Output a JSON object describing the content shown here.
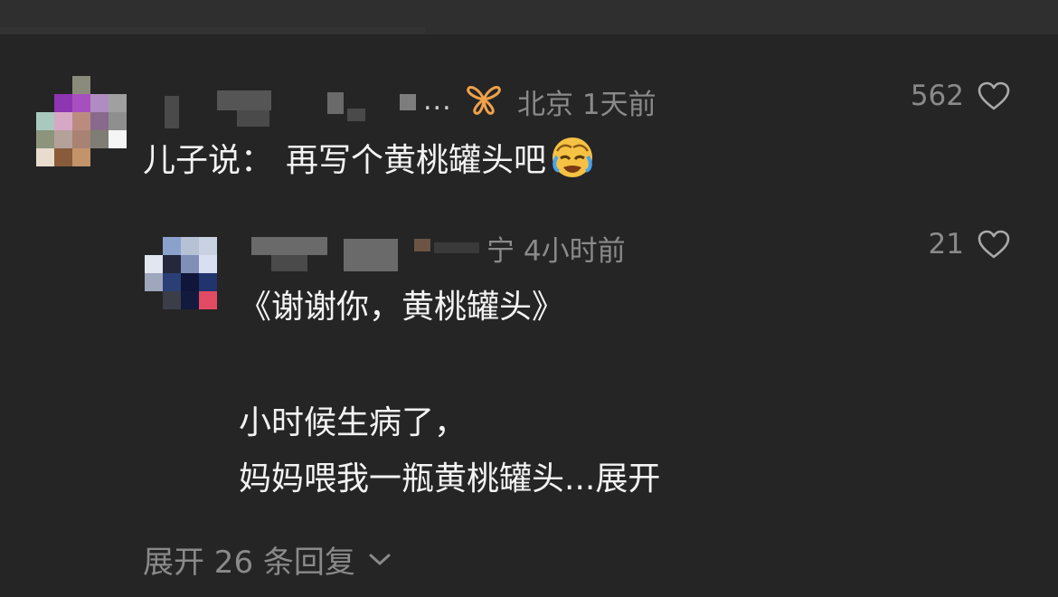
{
  "colors": {
    "background": "#252525",
    "top_bar": "#2f2f2f",
    "primary_text": "#f3f3f3",
    "secondary_text": "#8a8a8a",
    "badge_orange": "#f0a14a"
  },
  "comment": {
    "avatar_icon": "pixelated-avatar-icon",
    "username_ellipsis": "...",
    "badge_icon": "butterfly-badge-icon",
    "meta": "北京 1天前",
    "like_count": "562",
    "label": "儿子说：",
    "text": "再写个黄桃罐头吧",
    "emoji_icon": "face-holding-back-tears-emoji"
  },
  "reply": {
    "avatar_icon": "pixelated-avatar-icon",
    "meta": "宁 4小时前",
    "like_count": "21",
    "line1": "《谢谢你，黄桃罐头》",
    "line3": "小时候生病了，",
    "line4": "妈妈喂我一瓶黄桃罐头...",
    "expand_label": "展开"
  },
  "expand_replies": {
    "label": "展开 26 条回复",
    "icon": "chevron-down-icon"
  }
}
